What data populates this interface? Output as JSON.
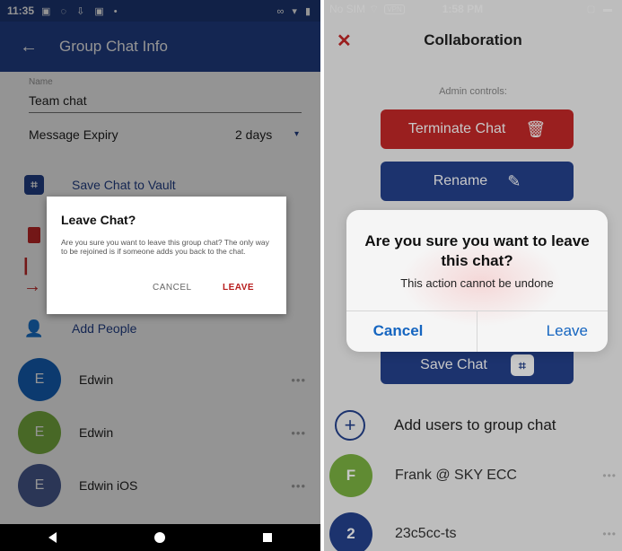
{
  "android": {
    "status": {
      "time": "11:35",
      "left_icons": "▣ ◌ ⇩ ▣ •",
      "right_icons": "∞ ▾ ▮"
    },
    "appbar": {
      "back_glyph": "←",
      "title": "Group Chat Info"
    },
    "name_field": {
      "label": "Name",
      "value": "Team chat"
    },
    "expiry": {
      "label": "Message Expiry",
      "value": "2 days",
      "caret": "▾"
    },
    "rows": {
      "save_vault": {
        "label": "Save Chat to Vault",
        "icon": "vault-icon",
        "glyph": "⌗"
      },
      "delete": {
        "icon": "trash-icon"
      },
      "leave": {
        "icon": "exit-icon",
        "glyph": "|→"
      },
      "add_people": {
        "label": "Add People",
        "icon": "add-person-icon",
        "glyph": "👤"
      }
    },
    "members": [
      {
        "initial": "E",
        "name": "Edwin",
        "color": "#1565c0"
      },
      {
        "initial": "E",
        "name": "Edwin",
        "color": "#7cb342"
      },
      {
        "initial": "E",
        "name": "Edwin iOS",
        "color": "#4a5e95"
      }
    ],
    "more_glyph": "•••",
    "dialog": {
      "title": "Leave Chat?",
      "body": "Are you sure you want to leave this group chat? The only way to be rejoined is if someone adds you back to the chat.",
      "cancel": "CANCEL",
      "leave": "LEAVE"
    }
  },
  "ios": {
    "status": {
      "carrier": "No SIM",
      "wifi": "⌔",
      "vpn": "VPN",
      "time": "1:58 PM",
      "battery": "▢ ▬"
    },
    "navbar": {
      "close_glyph": "✕",
      "title": "Collaboration"
    },
    "admin_label": "Admin controls:",
    "terminate": {
      "label": "Terminate Chat",
      "icon_glyph": "🗑"
    },
    "rename": {
      "label": "Rename",
      "icon_glyph": "✎"
    },
    "save_chat": {
      "label": "Save Chat",
      "icon_glyph": "⌗"
    },
    "add_users": {
      "label": "Add users to group chat",
      "glyph": "+"
    },
    "members": [
      {
        "initial": "F",
        "name": "Frank @ SKY ECC",
        "color": "#7cb342"
      },
      {
        "initial": "2",
        "name": "23c5cc-ts",
        "color": "#24428e"
      }
    ],
    "more_glyph": "•••",
    "alert": {
      "title": "Are you sure you want to leave this chat?",
      "message": "This action cannot be undone",
      "cancel": "Cancel",
      "leave": "Leave"
    },
    "colors": {
      "accent": "#24428e",
      "danger": "#c62828",
      "link": "#1565c0"
    }
  }
}
